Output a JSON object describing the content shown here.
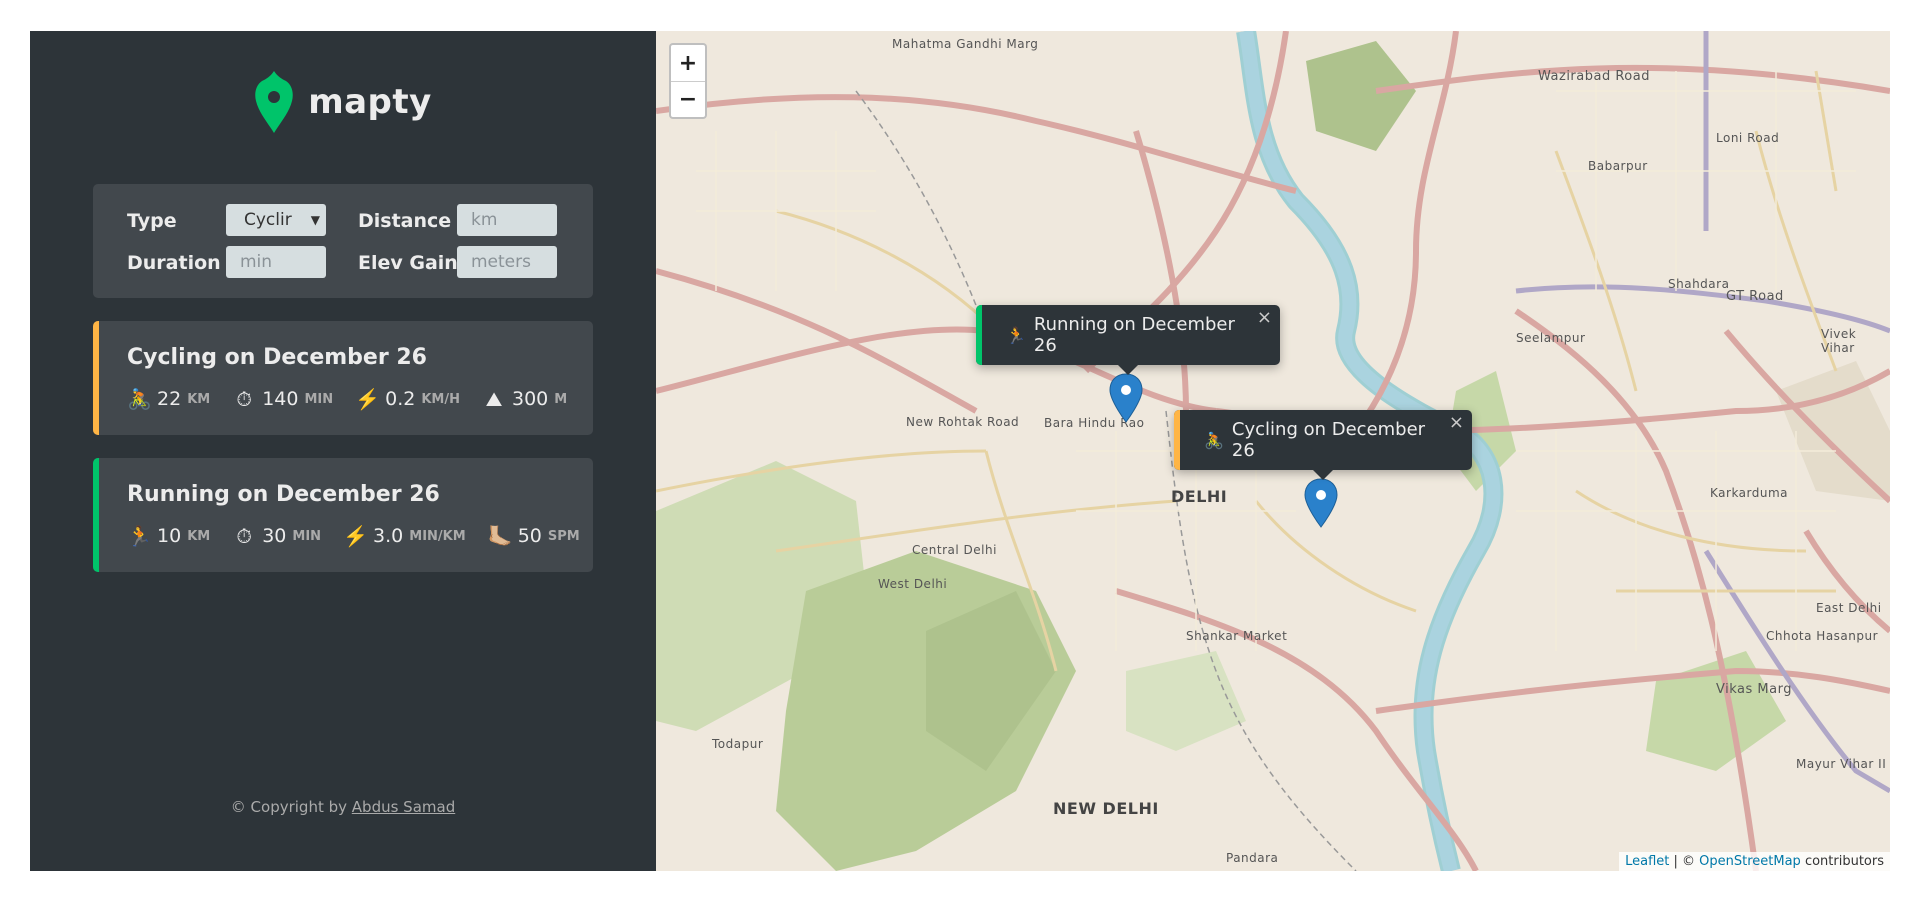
{
  "app": {
    "logo_text": "mapty"
  },
  "form": {
    "type_label": "Type",
    "type_value": "Cyclir",
    "distance_label": "Distance",
    "distance_placeholder": "km",
    "duration_label": "Duration",
    "duration_placeholder": "min",
    "elev_label": "Elev Gain",
    "elev_placeholder": "meters"
  },
  "workouts": [
    {
      "title": "Cycling on December 26",
      "accent": "#ffb545",
      "details": [
        {
          "icon": "🚴",
          "value": "22",
          "unit": "km"
        },
        {
          "icon": "⏱",
          "value": "140",
          "unit": "min"
        },
        {
          "icon": "⚡️",
          "value": "0.2",
          "unit": "km/h"
        },
        {
          "icon": "⛰",
          "value": "300",
          "unit": "m"
        }
      ]
    },
    {
      "title": "Running on December 26",
      "accent": "#00c46a",
      "details": [
        {
          "icon": "🏃",
          "value": "10",
          "unit": "km"
        },
        {
          "icon": "⏱",
          "value": "30",
          "unit": "min"
        },
        {
          "icon": "⚡️",
          "value": "3.0",
          "unit": "min/km"
        },
        {
          "icon": "🦶🏼",
          "value": "50",
          "unit": "spm"
        }
      ]
    }
  ],
  "copyright": {
    "prefix": "© Copyright by ",
    "author": "Abdus Samad"
  },
  "map": {
    "zoom_in": "+",
    "zoom_out": "−",
    "popups": [
      {
        "icon": "🏃",
        "text": "Running on December 26",
        "accent": "#00c46a",
        "close": "×"
      },
      {
        "icon": "🚴",
        "text": "Cycling on December 26",
        "accent": "#ffb545",
        "close": "×"
      }
    ],
    "places": {
      "delhi": "DELHI",
      "new_delhi": "NEW DELHI",
      "wazirabad_road": "Wazirabad Road",
      "gt_road": "GT Road",
      "vikas_marg": "Vikas Marg",
      "shankar_market": "Shankar Market",
      "todapur": "Todapur",
      "pandara": "Pandara",
      "central_delhi": "Central Delhi",
      "west_delhi": "West Delhi",
      "new_rohtak_road": "New Rohtak Road",
      "mahatma_gandhi_marg": "Mahatma Gandhi Marg",
      "babarpur": "Babarpur",
      "shahdara": "Shahdara",
      "karkarduma": "Karkarduma",
      "seelampur": "Seelampur",
      "east_delhi": "East Delhi",
      "mayur_vihar": "Mayur Vihar II",
      "chhota_hasanpur": "Chhota Hasanpur",
      "bara_hindu_rao": "Bara Hindu Rao",
      "loni_road": "Loni Road",
      "vivek_vihar": "Vivek Vihar"
    },
    "attribution": {
      "leaflet": "Leaflet",
      "sep": " | © ",
      "osm": "OpenStreetMap",
      "suffix": " contributors"
    }
  }
}
